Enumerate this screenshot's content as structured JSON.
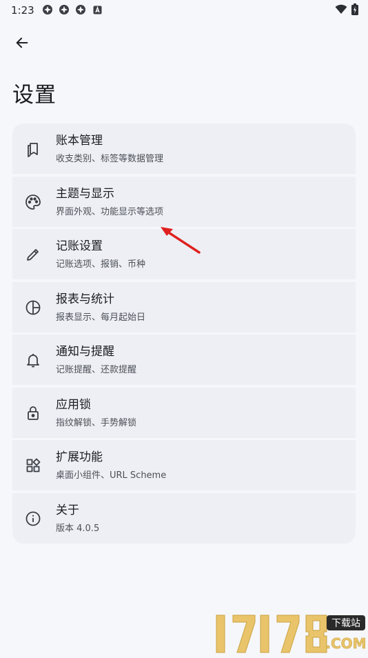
{
  "status_bar": {
    "time": "1:23",
    "left_icons": [
      "app-notification-icon",
      "app-notification-icon",
      "app-notification-icon",
      "android-a-icon"
    ],
    "right_icons": [
      "wifi-icon",
      "battery-charging-icon"
    ]
  },
  "header": {
    "back_icon": "arrow-left-icon",
    "title": "设置"
  },
  "settings": [
    {
      "key": "account-management",
      "icon": "bookmarks-icon",
      "title": "账本管理",
      "subtitle": "收支类别、标签等数据管理"
    },
    {
      "key": "theme-display",
      "icon": "palette-icon",
      "title": "主题与显示",
      "subtitle": "界面外观、功能显示等选项"
    },
    {
      "key": "bookkeeping-settings",
      "icon": "pencil-icon",
      "title": "记账设置",
      "subtitle": "记账选项、报销、币种"
    },
    {
      "key": "reports-statistics",
      "icon": "pie-chart-icon",
      "title": "报表与统计",
      "subtitle": "报表显示、每月起始日"
    },
    {
      "key": "notifications-reminders",
      "icon": "bell-icon",
      "title": "通知与提醒",
      "subtitle": "记账提醒、还款提醒"
    },
    {
      "key": "app-lock",
      "icon": "lock-icon",
      "title": "应用锁",
      "subtitle": "指纹解锁、手势解锁"
    },
    {
      "key": "extensions",
      "icon": "widgets-icon",
      "title": "扩展功能",
      "subtitle": "桌面小组件、URL Scheme"
    },
    {
      "key": "about",
      "icon": "info-icon",
      "title": "关于",
      "subtitle": "版本 4.0.5"
    }
  ],
  "annotation": {
    "color": "#e02020"
  },
  "watermark": {
    "brand": "17178",
    "badge": "下载站",
    "domain": ".COM"
  },
  "colors": {
    "background": "#f6f7fb",
    "card": "#edeff4",
    "text_primary": "#1b1c20",
    "text_secondary": "#4c4f57"
  }
}
